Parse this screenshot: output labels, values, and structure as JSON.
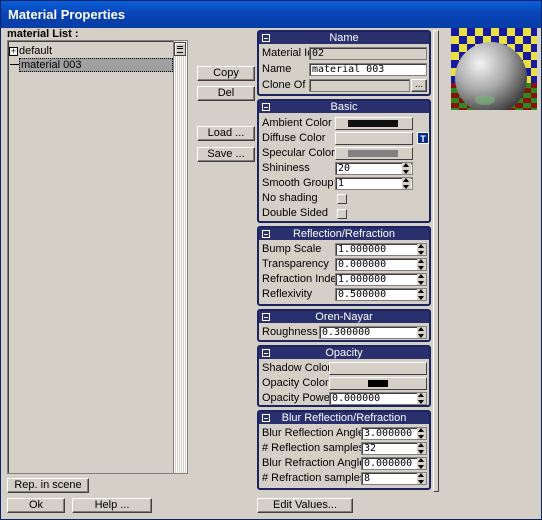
{
  "window": {
    "title": "Material Properties"
  },
  "list": {
    "label": "material List :",
    "items": [
      {
        "label": "default",
        "expander": "+"
      },
      {
        "label": "material 003"
      }
    ]
  },
  "buttons": {
    "copy": "Copy",
    "del": "Del",
    "load": "Load ...",
    "save": "Save ...",
    "rep_in_scene": "Rep. in scene",
    "ok": "Ok",
    "help": "Help ...",
    "edit_values": "Edit Values..."
  },
  "name_panel": {
    "header": "Name",
    "material_id_label": "Material Id",
    "material_id": "02",
    "name_label": "Name",
    "name": "material 003",
    "clone_of_label": "Clone Of",
    "clone_of": "",
    "clone_button": "..."
  },
  "basic_panel": {
    "header": "Basic",
    "ambient_label": "Ambient Color",
    "ambient_color": "#111111",
    "diffuse_label": "Diffuse Color",
    "diffuse_color": "#d4d0c8",
    "texture_button": "T",
    "specular_label": "Specular Color",
    "specular_color": "#808080",
    "shininess_label": "Shininess",
    "shininess": "20",
    "smooth_group_label": "Smooth Group",
    "smooth_group": "1",
    "no_shading_label": "No shading",
    "double_sided_label": "Double Sided"
  },
  "reflection_panel": {
    "header": "Reflection/Refraction",
    "bump_scale_label": "Bump Scale",
    "bump_scale": "1.000000",
    "transparency_label": "Transparency",
    "transparency": "0.000000",
    "refraction_index_label": "Refraction Index",
    "refraction_index": "1.000000",
    "reflexivity_label": "Reflexivity",
    "reflexivity": "0.500000"
  },
  "oren_panel": {
    "header": "Oren-Nayar",
    "roughness_label": "Roughness",
    "roughness": "0.300000"
  },
  "opacity_panel": {
    "header": "Opacity",
    "shadow_color_label": "Shadow Color",
    "shadow_color": "#d4d0c8",
    "opacity_color_label": "Opacity Color",
    "opacity_color": "#000000",
    "opacity_power_label": "Opacity Power",
    "opacity_power": "0.000000"
  },
  "blur_panel": {
    "header": "Blur Reflection/Refraction",
    "blur_reflection_angle_label": "Blur Reflection Angle",
    "blur_reflection_angle": "3.000000",
    "reflection_samples_label": "# Reflection samples",
    "reflection_samples": "32",
    "blur_refraction_angle_label": "Blur Refraction Angle",
    "blur_refraction_angle": "0.000000",
    "refraction_samples_label": "# Refraction samples",
    "refraction_samples": "8"
  },
  "colors": {
    "titlebar": "#0842b4",
    "panel_header": "#2a2f6e",
    "checker_yellow": "#e8e040",
    "checker_blue": "#1a1aa0"
  }
}
